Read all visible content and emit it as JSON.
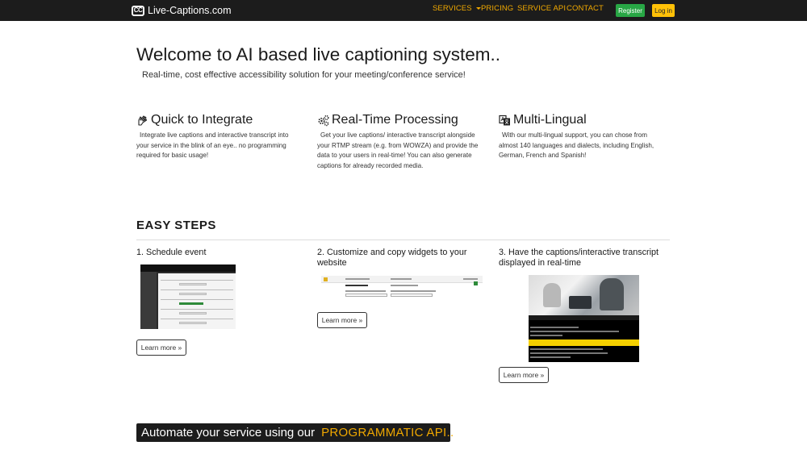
{
  "navbar": {
    "brand_logo": "CC",
    "brand_name": "Live-Captions.com",
    "links": {
      "services": "SERVICES",
      "pricing": "PRICING",
      "service_api": "SERVICE API",
      "contact": "CONTACT"
    },
    "register_label": "Register",
    "login_label": "Log in",
    "accent_color": "#f0a800"
  },
  "hero": {
    "title": "Welcome to AI based live captioning system..",
    "subtitle": "Real-time, cost effective accessibility solution for your meeting/conference service!"
  },
  "features": [
    {
      "icon": "sign-language-icon",
      "title": "Quick to Integrate",
      "text": "Integrate live captions and interactive transcript into your service in the blink of an eye.. no programming required for basic usage!"
    },
    {
      "icon": "gears-icon",
      "title": "Real-Time Processing",
      "text": "Get your live captions/ interactive transcript alongside your RTMP stream (e.g. from WOWZA) and provide the data to your users in real-time! You can also generate captions for already recorded media."
    },
    {
      "icon": "language-icon",
      "title": "Multi-Lingual",
      "text": "With our multi-lingual support, you can chose from almost 140 languages and dialects, including English, German, French and Spanish!"
    }
  ],
  "steps": {
    "heading": "EASY STEPS",
    "items": [
      {
        "title": "1. Schedule event",
        "learn_more": "Learn more »"
      },
      {
        "title": "2. Customize and copy widgets to your website",
        "learn_more": "Learn more »"
      },
      {
        "title": "3. Have the captions/interactive transcript displayed in real-time",
        "learn_more": "Learn more »"
      }
    ]
  },
  "api_banner": {
    "text": "Automate your service using our",
    "accent": "PROGRAMMATIC API.."
  }
}
